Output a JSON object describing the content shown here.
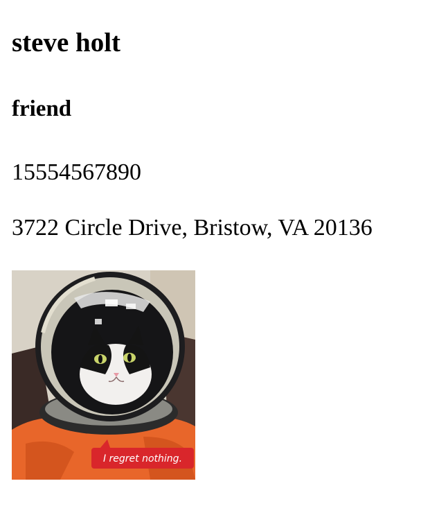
{
  "contact": {
    "name": "steve holt",
    "relation": "friend",
    "phone": "15554567890",
    "address": "3722 Circle Drive, Bristow, VA 20136",
    "photo": {
      "icon": "contact-photo-cat-astronaut",
      "caption": "I regret nothing."
    }
  },
  "colors": {
    "text": "#000000",
    "background": "#ffffff",
    "suit_orange": "#e8662a",
    "caption_red": "#d9262b"
  }
}
